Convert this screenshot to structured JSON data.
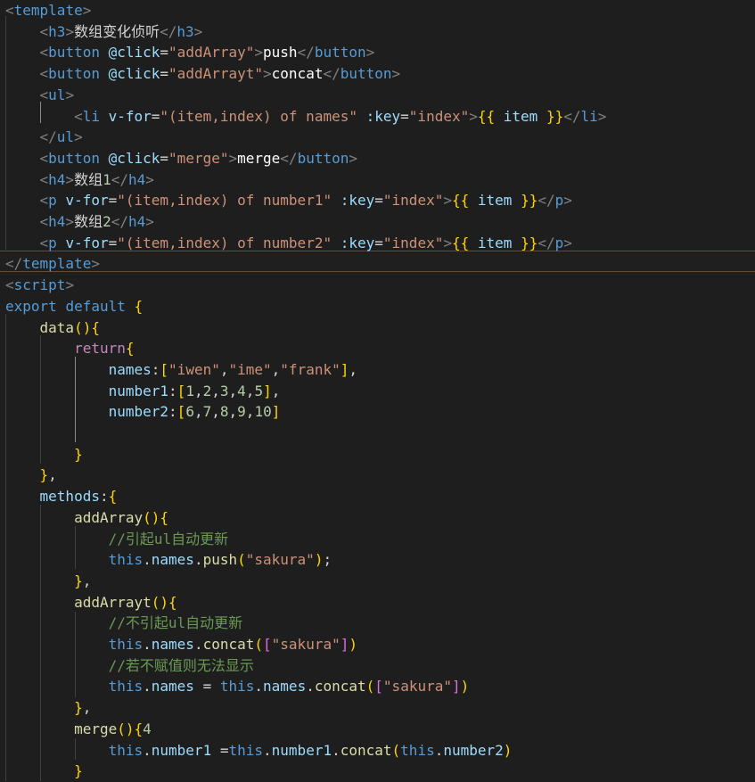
{
  "theme": {
    "background": "#1e1e1e",
    "tag_bracket": "#808080",
    "tag_name": "#569cd6",
    "attribute": "#9cdcfe",
    "string": "#ce9178",
    "keyword": "#569cd6",
    "control_keyword": "#c586c0",
    "function": "#dcdcaa",
    "number": "#b5cea8",
    "comment": "#6a9955",
    "bracket_level_1": "#ffd700",
    "bracket_level_2": "#da70d6",
    "bracket_level_3": "#179fff"
  },
  "code": {
    "template_lines": [
      "<template>",
      "    <h3>数组变化侦听</h3>",
      "    <button @click=\"addArray\">push</button>",
      "    <button @click=\"addArrayt\">concat</button>",
      "    <ul>",
      "        <li v-for=\"(item,index) of names\" :key=\"index\">{{ item }}</li>",
      "    </ul>",
      "    <button @click=\"merge\">merge</button>",
      "    <h4>数组1</h4>",
      "    <p v-for=\"(item,index) of number1\" :key=\"index\">{{ item }}</p>",
      "    <h4>数组2</h4>",
      "    <p v-for=\"(item,index) of number2\" :key=\"index\">{{ item }}</p>",
      "</template>"
    ],
    "script_lines": [
      "<script>",
      "export default {",
      "    data(){",
      "        return{",
      "            names:[\"iwen\",\"ime\",\"frank\"],",
      "            number1:[1,2,3,4,5],",
      "            number2:[6,7,8,9,10]",
      "",
      "        }",
      "    },",
      "    methods:{",
      "        addArray(){",
      "            //引起ul自动更新",
      "            this.names.push(\"sakura\");",
      "        },",
      "        addArrayt(){",
      "            //不引起ul自动更新",
      "            this.names.concat([\"sakura\"])",
      "            //若不赋值则无法显示",
      "            this.names = this.names.concat([\"sakura\"])",
      "        },",
      "        merge(){4",
      "            this.number1 =this.number1.concat(this.number2)",
      "        }"
    ],
    "highlighted_line": 13
  }
}
